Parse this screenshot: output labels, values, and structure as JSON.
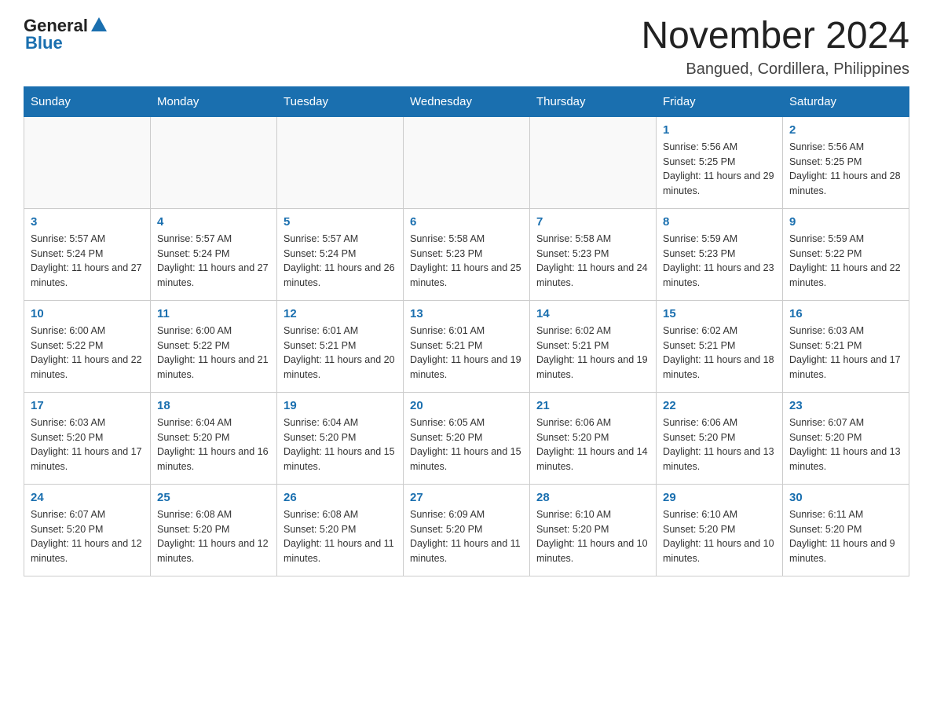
{
  "logo": {
    "general_text": "General",
    "blue_text": "Blue"
  },
  "title": "November 2024",
  "subtitle": "Bangued, Cordillera, Philippines",
  "days_of_week": [
    "Sunday",
    "Monday",
    "Tuesday",
    "Wednesday",
    "Thursday",
    "Friday",
    "Saturday"
  ],
  "weeks": [
    [
      {
        "day": "",
        "info": ""
      },
      {
        "day": "",
        "info": ""
      },
      {
        "day": "",
        "info": ""
      },
      {
        "day": "",
        "info": ""
      },
      {
        "day": "",
        "info": ""
      },
      {
        "day": "1",
        "info": "Sunrise: 5:56 AM\nSunset: 5:25 PM\nDaylight: 11 hours and 29 minutes."
      },
      {
        "day": "2",
        "info": "Sunrise: 5:56 AM\nSunset: 5:25 PM\nDaylight: 11 hours and 28 minutes."
      }
    ],
    [
      {
        "day": "3",
        "info": "Sunrise: 5:57 AM\nSunset: 5:24 PM\nDaylight: 11 hours and 27 minutes."
      },
      {
        "day": "4",
        "info": "Sunrise: 5:57 AM\nSunset: 5:24 PM\nDaylight: 11 hours and 27 minutes."
      },
      {
        "day": "5",
        "info": "Sunrise: 5:57 AM\nSunset: 5:24 PM\nDaylight: 11 hours and 26 minutes."
      },
      {
        "day": "6",
        "info": "Sunrise: 5:58 AM\nSunset: 5:23 PM\nDaylight: 11 hours and 25 minutes."
      },
      {
        "day": "7",
        "info": "Sunrise: 5:58 AM\nSunset: 5:23 PM\nDaylight: 11 hours and 24 minutes."
      },
      {
        "day": "8",
        "info": "Sunrise: 5:59 AM\nSunset: 5:23 PM\nDaylight: 11 hours and 23 minutes."
      },
      {
        "day": "9",
        "info": "Sunrise: 5:59 AM\nSunset: 5:22 PM\nDaylight: 11 hours and 22 minutes."
      }
    ],
    [
      {
        "day": "10",
        "info": "Sunrise: 6:00 AM\nSunset: 5:22 PM\nDaylight: 11 hours and 22 minutes."
      },
      {
        "day": "11",
        "info": "Sunrise: 6:00 AM\nSunset: 5:22 PM\nDaylight: 11 hours and 21 minutes."
      },
      {
        "day": "12",
        "info": "Sunrise: 6:01 AM\nSunset: 5:21 PM\nDaylight: 11 hours and 20 minutes."
      },
      {
        "day": "13",
        "info": "Sunrise: 6:01 AM\nSunset: 5:21 PM\nDaylight: 11 hours and 19 minutes."
      },
      {
        "day": "14",
        "info": "Sunrise: 6:02 AM\nSunset: 5:21 PM\nDaylight: 11 hours and 19 minutes."
      },
      {
        "day": "15",
        "info": "Sunrise: 6:02 AM\nSunset: 5:21 PM\nDaylight: 11 hours and 18 minutes."
      },
      {
        "day": "16",
        "info": "Sunrise: 6:03 AM\nSunset: 5:21 PM\nDaylight: 11 hours and 17 minutes."
      }
    ],
    [
      {
        "day": "17",
        "info": "Sunrise: 6:03 AM\nSunset: 5:20 PM\nDaylight: 11 hours and 17 minutes."
      },
      {
        "day": "18",
        "info": "Sunrise: 6:04 AM\nSunset: 5:20 PM\nDaylight: 11 hours and 16 minutes."
      },
      {
        "day": "19",
        "info": "Sunrise: 6:04 AM\nSunset: 5:20 PM\nDaylight: 11 hours and 15 minutes."
      },
      {
        "day": "20",
        "info": "Sunrise: 6:05 AM\nSunset: 5:20 PM\nDaylight: 11 hours and 15 minutes."
      },
      {
        "day": "21",
        "info": "Sunrise: 6:06 AM\nSunset: 5:20 PM\nDaylight: 11 hours and 14 minutes."
      },
      {
        "day": "22",
        "info": "Sunrise: 6:06 AM\nSunset: 5:20 PM\nDaylight: 11 hours and 13 minutes."
      },
      {
        "day": "23",
        "info": "Sunrise: 6:07 AM\nSunset: 5:20 PM\nDaylight: 11 hours and 13 minutes."
      }
    ],
    [
      {
        "day": "24",
        "info": "Sunrise: 6:07 AM\nSunset: 5:20 PM\nDaylight: 11 hours and 12 minutes."
      },
      {
        "day": "25",
        "info": "Sunrise: 6:08 AM\nSunset: 5:20 PM\nDaylight: 11 hours and 12 minutes."
      },
      {
        "day": "26",
        "info": "Sunrise: 6:08 AM\nSunset: 5:20 PM\nDaylight: 11 hours and 11 minutes."
      },
      {
        "day": "27",
        "info": "Sunrise: 6:09 AM\nSunset: 5:20 PM\nDaylight: 11 hours and 11 minutes."
      },
      {
        "day": "28",
        "info": "Sunrise: 6:10 AM\nSunset: 5:20 PM\nDaylight: 11 hours and 10 minutes."
      },
      {
        "day": "29",
        "info": "Sunrise: 6:10 AM\nSunset: 5:20 PM\nDaylight: 11 hours and 10 minutes."
      },
      {
        "day": "30",
        "info": "Sunrise: 6:11 AM\nSunset: 5:20 PM\nDaylight: 11 hours and 9 minutes."
      }
    ]
  ]
}
